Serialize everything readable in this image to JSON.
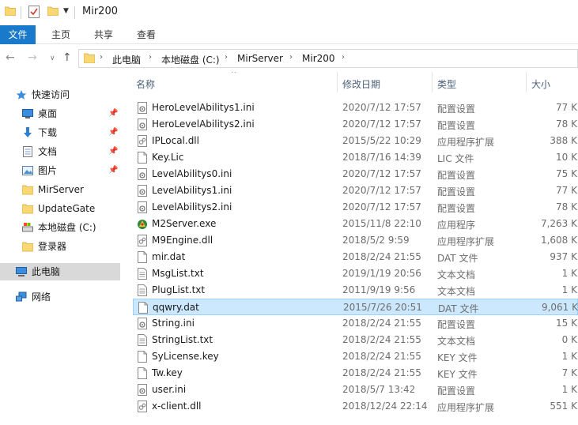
{
  "window": {
    "title": "Mir200"
  },
  "ribbon": {
    "tabs": [
      "文件",
      "主页",
      "共享",
      "查看"
    ]
  },
  "address": {
    "segments": [
      "此电脑",
      "本地磁盘 (C:)",
      "MirServer",
      "Mir200"
    ]
  },
  "sidebar": {
    "items": [
      {
        "label": "快速访问",
        "icon": "star-icon"
      },
      {
        "label": "桌面",
        "icon": "desktop-icon",
        "pinned": true
      },
      {
        "label": "下载",
        "icon": "download-icon",
        "pinned": true
      },
      {
        "label": "文档",
        "icon": "document-icon",
        "pinned": true
      },
      {
        "label": "图片",
        "icon": "picture-icon",
        "pinned": true
      },
      {
        "label": "MirServer",
        "icon": "folder-icon"
      },
      {
        "label": "UpdateGate",
        "icon": "folder-icon"
      },
      {
        "label": "本地磁盘 (C:)",
        "icon": "drive-icon"
      },
      {
        "label": "登录器",
        "icon": "folder-icon"
      },
      {
        "label": "此电脑",
        "icon": "computer-icon"
      },
      {
        "label": "网络",
        "icon": "network-icon"
      }
    ]
  },
  "columns": {
    "name": "名称",
    "date": "修改日期",
    "type": "类型",
    "size": "大小"
  },
  "files": [
    {
      "name": "HeroLevelAbilitys1.ini",
      "date": "2020/7/12 17:57",
      "type": "配置设置",
      "size": "77 K",
      "icon": "settings-file-icon"
    },
    {
      "name": "HeroLevelAbilitys2.ini",
      "date": "2020/7/12 17:57",
      "type": "配置设置",
      "size": "78 K",
      "icon": "settings-file-icon"
    },
    {
      "name": "IPLocal.dll",
      "date": "2015/5/22 10:29",
      "type": "应用程序扩展",
      "size": "388 K",
      "icon": "dll-file-icon"
    },
    {
      "name": "Key.Lic",
      "date": "2018/7/16 14:39",
      "type": "LIC 文件",
      "size": "10 K",
      "icon": "file-icon"
    },
    {
      "name": "LevelAbilitys0.ini",
      "date": "2020/7/12 17:57",
      "type": "配置设置",
      "size": "75 K",
      "icon": "settings-file-icon"
    },
    {
      "name": "LevelAbilitys1.ini",
      "date": "2020/7/12 17:57",
      "type": "配置设置",
      "size": "77 K",
      "icon": "settings-file-icon"
    },
    {
      "name": "LevelAbilitys2.ini",
      "date": "2020/7/12 17:57",
      "type": "配置设置",
      "size": "78 K",
      "icon": "settings-file-icon"
    },
    {
      "name": "M2Server.exe",
      "date": "2015/11/8 22:10",
      "type": "应用程序",
      "size": "7,263 K",
      "icon": "exe-file-icon"
    },
    {
      "name": "M9Engine.dll",
      "date": "2018/5/2 9:59",
      "type": "应用程序扩展",
      "size": "1,608 K",
      "icon": "dll-file-icon"
    },
    {
      "name": "mir.dat",
      "date": "2018/2/24 21:55",
      "type": "DAT 文件",
      "size": "937 K",
      "icon": "file-icon"
    },
    {
      "name": "MsgList.txt",
      "date": "2019/1/19 20:56",
      "type": "文本文档",
      "size": "1 K",
      "icon": "text-file-icon"
    },
    {
      "name": "PlugList.txt",
      "date": "2011/9/19 9:56",
      "type": "文本文档",
      "size": "1 K",
      "icon": "text-file-icon"
    },
    {
      "name": "qqwry.dat",
      "date": "2015/7/26 20:51",
      "type": "DAT 文件",
      "size": "9,061 K",
      "icon": "file-icon",
      "selected": true
    },
    {
      "name": "String.ini",
      "date": "2018/2/24 21:55",
      "type": "配置设置",
      "size": "15 K",
      "icon": "settings-file-icon"
    },
    {
      "name": "StringList.txt",
      "date": "2018/2/24 21:55",
      "type": "文本文档",
      "size": "0 K",
      "icon": "text-file-icon"
    },
    {
      "name": "SyLicense.key",
      "date": "2018/2/24 21:55",
      "type": "KEY 文件",
      "size": "1 K",
      "icon": "file-icon"
    },
    {
      "name": "Tw.key",
      "date": "2018/2/24 21:55",
      "type": "KEY 文件",
      "size": "7 K",
      "icon": "file-icon"
    },
    {
      "name": "user.ini",
      "date": "2018/5/7 13:42",
      "type": "配置设置",
      "size": "1 K",
      "icon": "settings-file-icon"
    },
    {
      "name": "x-client.dll",
      "date": "2018/12/24 22:14",
      "type": "应用程序扩展",
      "size": "551 K",
      "icon": "dll-file-icon"
    }
  ],
  "colors": {
    "accent": "#1979ca",
    "selection": "#cce8ff",
    "folder": "#f8d775"
  }
}
